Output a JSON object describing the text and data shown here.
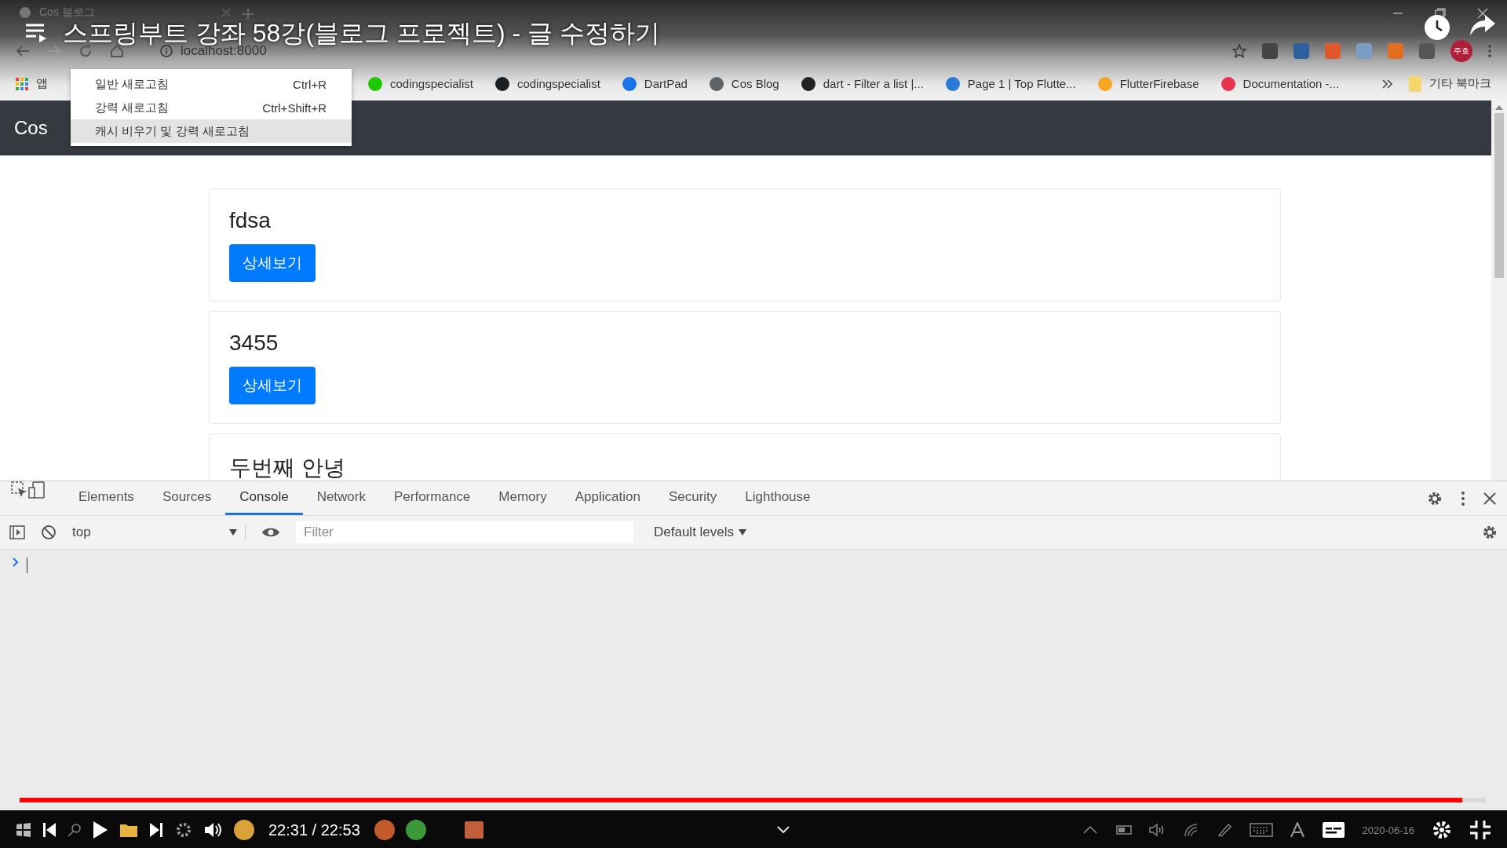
{
  "video": {
    "title": "스프링부트 강좌 58강(블로그 프로젝트) - 글 수정하기",
    "time": "22:31 / 22:53",
    "progress": {
      "level": 0.984
    }
  },
  "browser": {
    "tab_title": "Cos 블로그",
    "address": "localhost:8000",
    "profile": "주호",
    "other_bookmarks": "기타 북마크",
    "bookmarks": [
      {
        "kind": "apps",
        "label": "앱"
      },
      {
        "kind": "site",
        "label": "codingspecialist",
        "color": "#1ec800"
      },
      {
        "kind": "site",
        "label": "codingspecialist",
        "color": "#1b1f23"
      },
      {
        "kind": "site",
        "label": "DartPad",
        "color": "#1a73e8"
      },
      {
        "kind": "site",
        "label": "Cos Blog",
        "color": "#5f6368"
      },
      {
        "kind": "site",
        "label": "dart - Filter a list |...",
        "color": "#222222"
      },
      {
        "kind": "site",
        "label": "Page 1 | Top Flutte...",
        "color": "#2b7bd6"
      },
      {
        "kind": "site",
        "label": "FlutterFirebase",
        "color": "#f5a623"
      },
      {
        "kind": "site",
        "label": "Documentation -...",
        "color": "#e8344e"
      }
    ],
    "extensions": [
      {
        "color": "#444444"
      },
      {
        "color": "#2b5f9e"
      },
      {
        "color": "#e0592a"
      },
      {
        "color": "#7a9cc6"
      },
      {
        "color": "#e07020"
      },
      {
        "color": "#555555"
      }
    ]
  },
  "reload_menu": {
    "items": [
      {
        "label": "일반 새로고침",
        "shortcut": "Ctrl+R",
        "selected": false
      },
      {
        "label": "강력 새로고침",
        "shortcut": "Ctrl+Shift+R",
        "selected": false
      },
      {
        "label": "캐시 비우기 및 강력 새로고침",
        "selected": true
      }
    ]
  },
  "site": {
    "brand": "Cos",
    "posts": [
      {
        "title": "fdsa",
        "button": "상세보기"
      },
      {
        "title": "3455",
        "button": "상세보기"
      },
      {
        "title": "두번째 안녕"
      }
    ]
  },
  "devtools": {
    "tabs": [
      {
        "label": "Elements",
        "selected": false
      },
      {
        "label": "Sources",
        "selected": false
      },
      {
        "label": "Console",
        "selected": true
      },
      {
        "label": "Network",
        "selected": false
      },
      {
        "label": "Performance",
        "selected": false
      },
      {
        "label": "Memory",
        "selected": false
      },
      {
        "label": "Application",
        "selected": false
      },
      {
        "label": "Security",
        "selected": false
      },
      {
        "label": "Lighthouse",
        "selected": false
      }
    ],
    "context": "top",
    "filter_placeholder": "Filter",
    "levels": "Default levels"
  },
  "taskbar": {
    "date": "2020-06-16"
  }
}
